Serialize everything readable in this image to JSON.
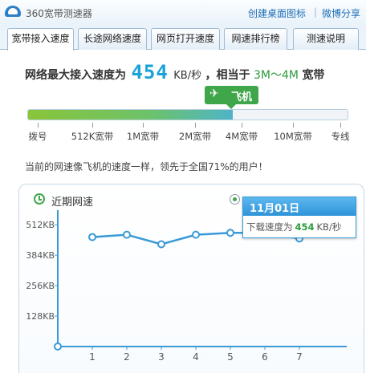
{
  "window": {
    "title": "360宽带测速器",
    "links": [
      "创建桌面图标",
      "微博分享"
    ],
    "separator": "|"
  },
  "tabs": [
    {
      "label": "宽带接入速度",
      "active": true
    },
    {
      "label": "长途网络速度",
      "active": false
    },
    {
      "label": "网页打开速度",
      "active": false
    },
    {
      "label": "网速排行榜",
      "active": false
    },
    {
      "label": "测速说明",
      "active": false
    }
  ],
  "headline": {
    "prefix": "网络最大接入速度为",
    "speed": "454",
    "unit": "KB/秒",
    "middle": "，相当于",
    "band": "3M～4M",
    "suffix": "宽带"
  },
  "badge": {
    "icon": "airplane-icon",
    "label": "飞机"
  },
  "speed_bar": {
    "fill_fraction": 0.64,
    "ticks": [
      "拨号",
      "512K宽带",
      "1M宽带",
      "2M宽带",
      "4M宽带",
      "10M宽带",
      "专线"
    ]
  },
  "message": "当前的网速像飞机的速度一样，领先于全国71%的用户！",
  "panel": {
    "title": "近期网速",
    "icon": "clock-icon"
  },
  "tooltip": {
    "date": "11月01日",
    "label": "下载速度为",
    "value": "454",
    "unit": "KB/秒"
  },
  "colors": {
    "accent_blue": "#1aa3d6",
    "accent_green": "#3fa64a",
    "line": "#3a9ad6"
  },
  "chart_data": {
    "type": "line",
    "x": [
      1,
      2,
      3,
      4,
      5,
      6,
      7
    ],
    "values": [
      460,
      470,
      430,
      470,
      478,
      478,
      454
    ],
    "origin_point": [
      0,
      0
    ],
    "yticks": [
      "512KB",
      "384KB",
      "256KB",
      "128KB"
    ],
    "ytick_values": [
      512,
      384,
      256,
      128
    ],
    "xticks": [
      "1",
      "2",
      "3",
      "4",
      "5",
      "6",
      "7"
    ],
    "ylim": [
      0,
      580
    ],
    "grid": false
  }
}
